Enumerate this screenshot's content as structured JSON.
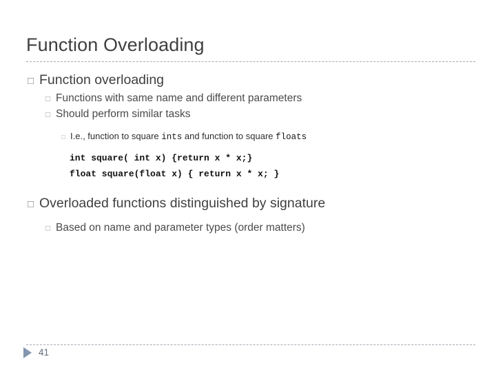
{
  "slide": {
    "title": "Function Overloading",
    "page_number": "41",
    "bullet_glyph": "□",
    "accent_color": "#8496b0",
    "title_color": "#404040",
    "rule_color": "#a6a6b4"
  },
  "content": {
    "b1": {
      "text": "Function overloading",
      "sub": [
        {
          "text": "Functions with same name and different parameters"
        },
        {
          "text": "Should perform similar tasks"
        }
      ],
      "example": {
        "lead": "I.e., function to square ",
        "mono1": "ints",
        "mid": " and function to square ",
        "mono2": "floats"
      },
      "code": [
        "int square( int x) {return x * x;}",
        "float square(float x) { return x * x; }"
      ]
    },
    "b2": {
      "text": "Overloaded functions distinguished by signature",
      "sub": [
        {
          "text": "Based on name and parameter types (order matters)"
        }
      ]
    }
  }
}
